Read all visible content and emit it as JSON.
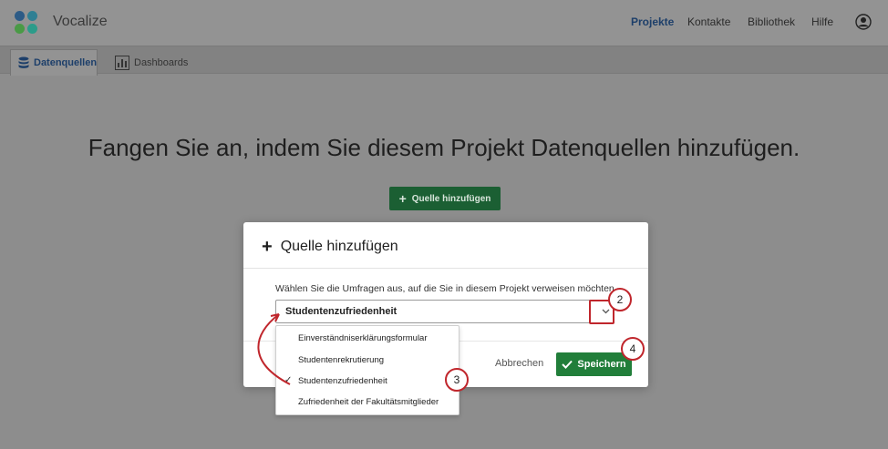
{
  "app": {
    "name": "Vocalize"
  },
  "nav": {
    "projects": "Projekte",
    "contacts": "Kontakte",
    "library": "Bibliothek",
    "help": "Hilfe"
  },
  "tabs": [
    {
      "label": "Datenquellen",
      "icon": "database-icon"
    },
    {
      "label": "Dashboards",
      "icon": "bar-chart-icon"
    }
  ],
  "main": {
    "heading": "Fangen Sie an, indem Sie diesem Projekt Datenquellen hinzufügen.",
    "add_source_label": "Quelle hinzufügen"
  },
  "modal": {
    "title": "Quelle hinzufügen",
    "instruction": "Wählen Sie die Umfragen aus, auf die Sie in diesem Projekt verweisen möchten.",
    "selected_value": "Studentenzufriedenheit",
    "cancel_label": "Abbrechen",
    "save_label": "Speichern"
  },
  "dropdown": {
    "options": [
      {
        "label": "Einverständniserklärungsformular",
        "selected": false
      },
      {
        "label": "Studentenrekrutierung",
        "selected": false
      },
      {
        "label": "Studentenzufriedenheit",
        "selected": true
      },
      {
        "label": "Zufriedenheit der Fakultätsmitglieder",
        "selected": false
      }
    ]
  },
  "steps": [
    "2",
    "3",
    "4"
  ],
  "colors": {
    "accent": "#1d3f6a",
    "primary_button": "#217e3a",
    "annotation": "#c0262c"
  }
}
